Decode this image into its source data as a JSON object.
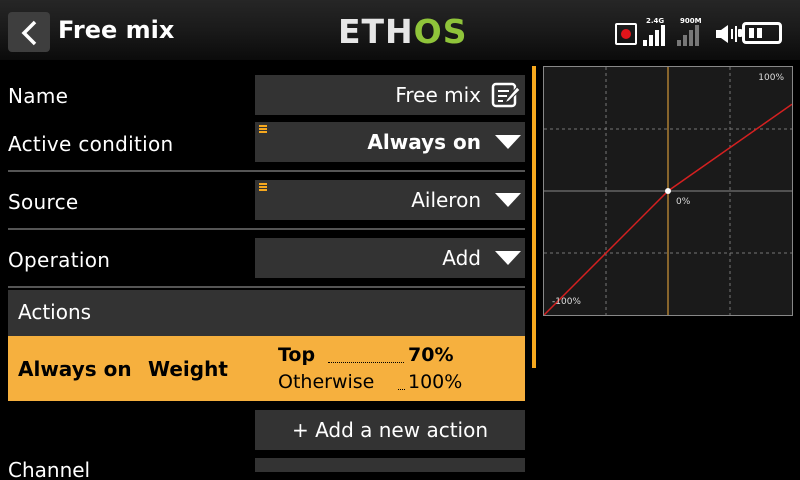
{
  "header": {
    "title": "Free mix",
    "logo_part1": "ETH",
    "logo_part2": "OS",
    "signal_24g": "2.4G",
    "signal_900m": "900M"
  },
  "form": {
    "name": {
      "label": "Name",
      "value": "Free mix"
    },
    "active_condition": {
      "label": "Active condition",
      "value": "Always on"
    },
    "source": {
      "label": "Source",
      "value": "Aileron"
    },
    "operation": {
      "label": "Operation",
      "value": "Add"
    }
  },
  "actions": {
    "header": "Actions",
    "row": {
      "condition": "Always on",
      "type": "Weight",
      "top_label": "Top",
      "top_value": "70%",
      "otherwise_label": "Otherwise",
      "otherwise_value": "100%"
    },
    "add_button": "+ Add a new action"
  },
  "next_row": {
    "label": "Channel"
  },
  "graph": {
    "max_label": "100%",
    "mid_label": "0%",
    "min_label": "-100%",
    "curve_points": [
      [
        -100,
        -100
      ],
      [
        0,
        0
      ],
      [
        100,
        70
      ]
    ],
    "curve_color": "#d42020",
    "center_line_color": "#f6b03e"
  },
  "colors": {
    "accent": "#f6b03e",
    "logo_green": "#8fc43a"
  }
}
